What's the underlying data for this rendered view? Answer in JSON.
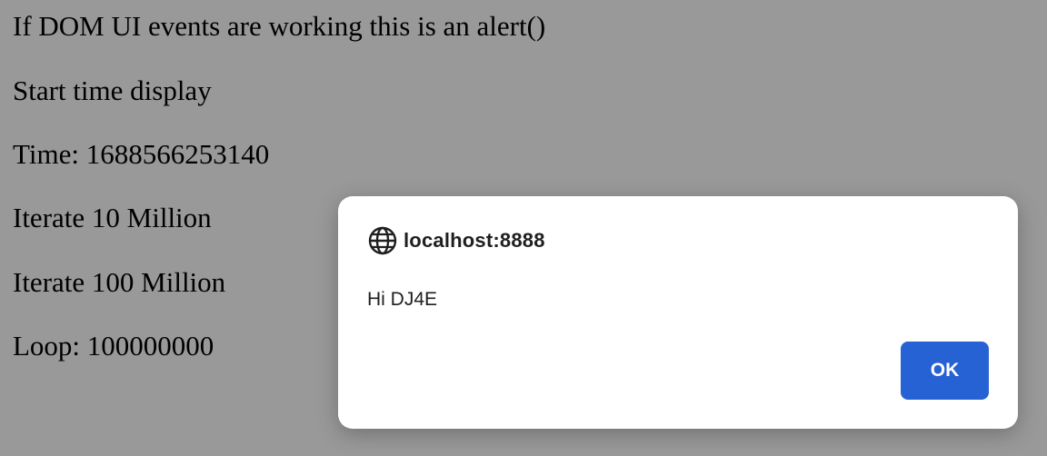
{
  "page": {
    "lines": [
      "If DOM UI events are working this is an alert()",
      "Start time display",
      "Time: 1688566253140",
      "Iterate 10 Million",
      "Iterate 100 Million",
      "Loop: 100000000"
    ]
  },
  "dialog": {
    "origin": "localhost:8888",
    "icon": "globe-icon",
    "message": "Hi DJ4E",
    "ok_label": "OK",
    "accent_color": "#2762d4"
  }
}
